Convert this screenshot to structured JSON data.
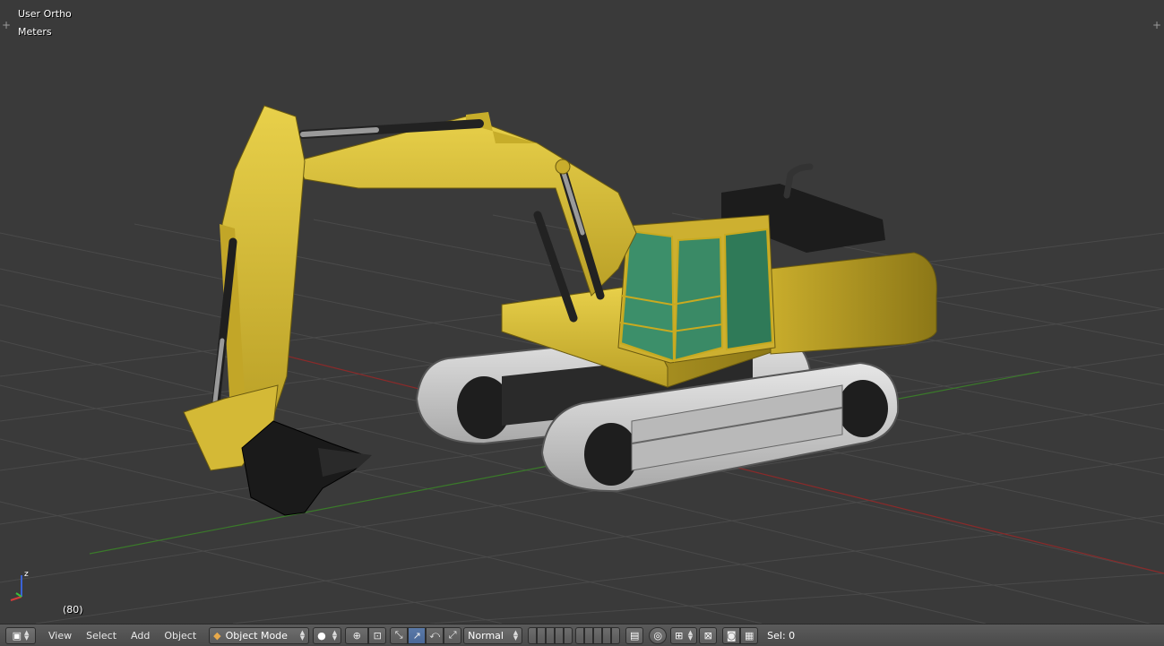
{
  "viewport": {
    "view_name": "User Ortho",
    "units": "Meters",
    "frame": "(80)",
    "axis_label": "z"
  },
  "header": {
    "editor_type_icon": "cube-icon",
    "menus": [
      "View",
      "Select",
      "Add",
      "Object"
    ],
    "mode": "Object Mode",
    "shading_icon": "solid-sphere-icon",
    "pivot_icon": "pivot-point-icon",
    "transform_orientation": "Normal",
    "selection_count": "Sel: 0"
  },
  "colors": {
    "body_yellow": "#d9c23a",
    "glass_green": "#3c8f6a",
    "track_gray": "#c8c8c8",
    "grid_line": "#4a4a4a",
    "x_axis": "#8a2a2a",
    "y_axis": "#3a7a2a",
    "header_bg": "#505050"
  }
}
